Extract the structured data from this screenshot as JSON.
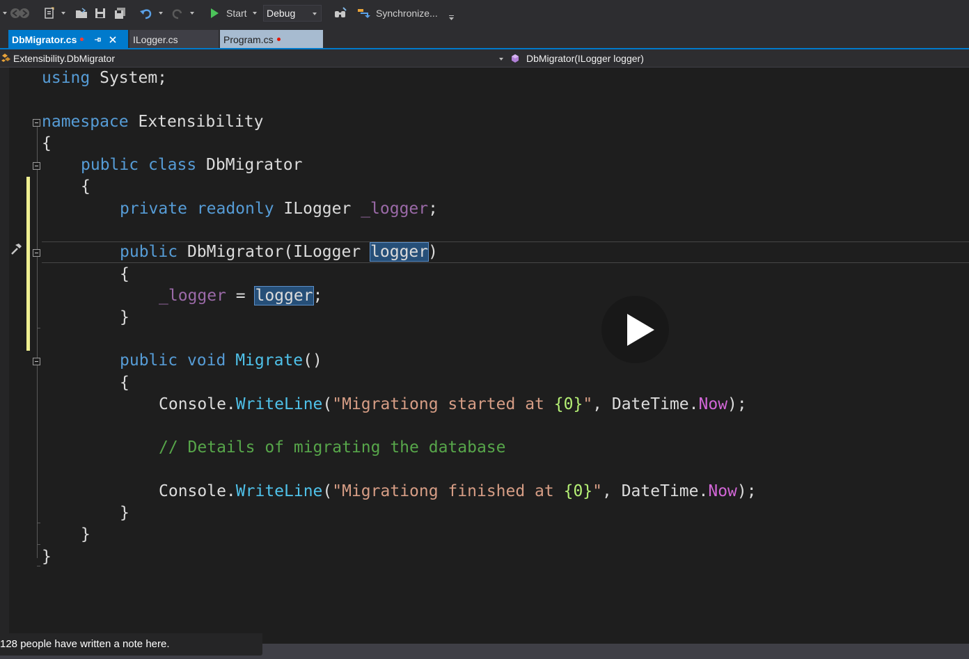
{
  "toolbar": {
    "start_label": "Start",
    "config_value": "Debug",
    "sync_label": "Synchronize..."
  },
  "tabs": [
    {
      "label": "DbMigrator.cs",
      "modified": true,
      "active": true
    },
    {
      "label": "ILogger.cs",
      "modified": false,
      "active": false
    },
    {
      "label": "Program.cs",
      "modified": true,
      "active": false
    }
  ],
  "navbar": {
    "type_path": "Extensibility.DbMigrator",
    "member": "DbMigrator(ILogger logger)"
  },
  "code": {
    "l1": {
      "kw": "using",
      "ns": " System;"
    },
    "l3": {
      "kw": "namespace",
      "name": " Extensibility"
    },
    "l4": {
      "brace": "{"
    },
    "l5": {
      "kw1": "public",
      "kw2": " class",
      "name": " DbMigrator"
    },
    "l6": {
      "brace": "{"
    },
    "l7": {
      "kw1": "private",
      "kw2": " readonly",
      "type": " ILogger",
      "field": " _logger",
      "end": ";"
    },
    "l9": {
      "kw1": "public",
      "name": " DbMigrator(ILogger ",
      "param": "logger",
      "end": ")"
    },
    "l10": {
      "brace": "{"
    },
    "l11": {
      "field": "_logger",
      "op": " = ",
      "param": "logger",
      "end": ";"
    },
    "l12": {
      "brace": "}"
    },
    "l14": {
      "kw1": "public",
      "kw2": " void",
      "method": " Migrate",
      "end": "()"
    },
    "l15": {
      "brace": "{"
    },
    "l16": {
      "cls": "Console.",
      "method": "WriteLine",
      "open": "(",
      "str1": "\"Migrationg started at ",
      "fmt": "{0}",
      "str2": "\"",
      "sep": ", DateTime.",
      "prop": "Now",
      "end": ");"
    },
    "l18": {
      "comment": "// Details of migrating the database"
    },
    "l20": {
      "cls": "Console.",
      "method": "WriteLine",
      "open": "(",
      "str1": "\"Migrationg finished at ",
      "fmt": "{0}",
      "str2": "\"",
      "sep": ", DateTime.",
      "prop": "Now",
      "end": ");"
    },
    "l21": {
      "brace": "}"
    },
    "l22": {
      "brace": "}"
    },
    "l23": {
      "brace": "}"
    }
  },
  "note": {
    "text": "128 people have written a note here."
  },
  "colors": {
    "accent": "#007acc",
    "change_bar": "#efef91",
    "selection": "#264f78"
  }
}
